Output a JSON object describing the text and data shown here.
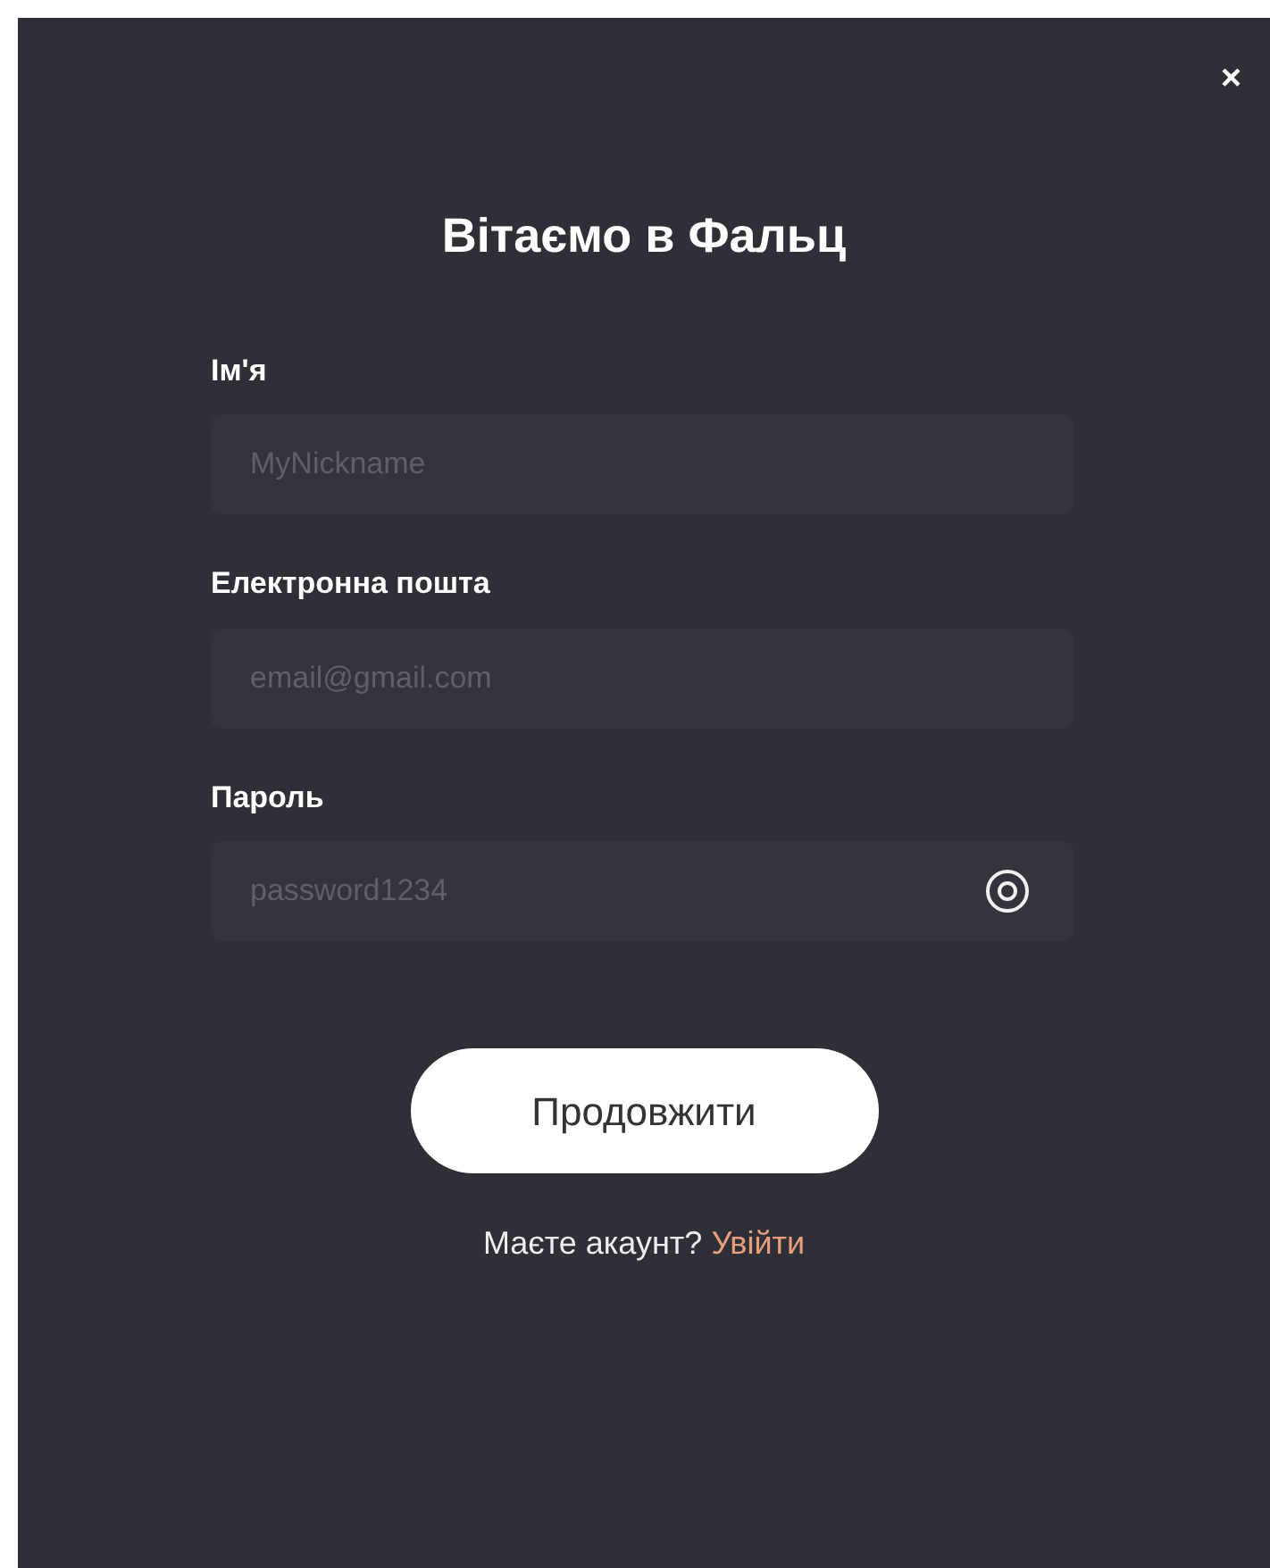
{
  "dialog": {
    "close": "×",
    "title": "Вітаємо в Фальц"
  },
  "fields": [
    {
      "kind": "text",
      "label": "Ім'я",
      "placeholder": "MyNickname"
    },
    {
      "kind": "text",
      "label": "Електронна пошта",
      "placeholder": "email@gmail.com"
    },
    {
      "kind": "password",
      "label": "Пароль",
      "placeholder": "password1234"
    }
  ],
  "submit": "Продовжити",
  "footer": {
    "text": "Маєте акаунт?",
    "link": "Увійти"
  }
}
